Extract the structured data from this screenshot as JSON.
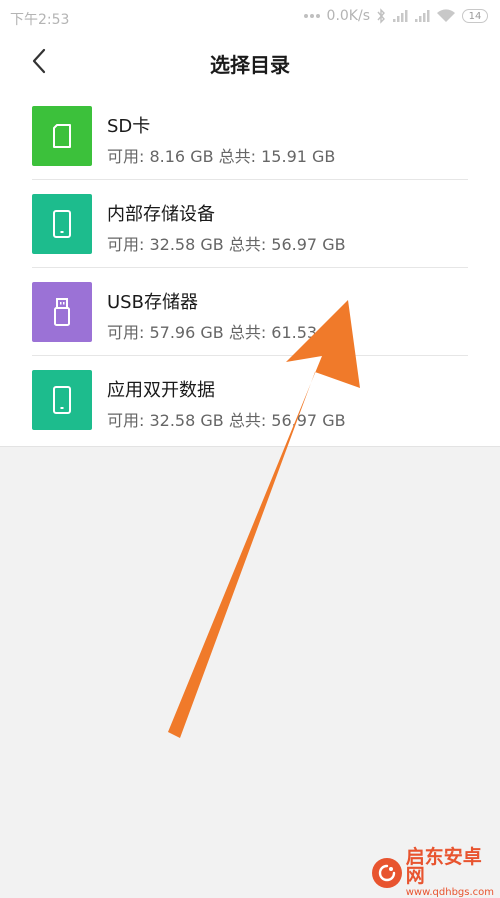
{
  "status_bar": {
    "time": "下午2:53",
    "network_speed": "0.0K/s",
    "battery": "14"
  },
  "header": {
    "title": "选择目录"
  },
  "storage_items": [
    {
      "name": "SD卡",
      "detail": "可用: 8.16 GB 总共: 15.91 GB",
      "icon": "sd-card-icon",
      "color": "#3cc13b"
    },
    {
      "name": "内部存储设备",
      "detail": "可用: 32.58 GB 总共: 56.97 GB",
      "icon": "phone-icon",
      "color": "#1dbc8d"
    },
    {
      "name": "USB存储器",
      "detail": "可用: 57.96 GB 总共: 61.53 GB",
      "icon": "usb-drive-icon",
      "color": "#9b72d6"
    },
    {
      "name": "应用双开数据",
      "detail": "可用: 32.58 GB 总共: 56.97 GB",
      "icon": "phone-icon",
      "color": "#1dbc8d"
    }
  ],
  "annotation": {
    "arrow_color": "#f07a2a"
  },
  "watermark": {
    "name": "启东安卓网",
    "url": "www.qdhbgs.com"
  }
}
